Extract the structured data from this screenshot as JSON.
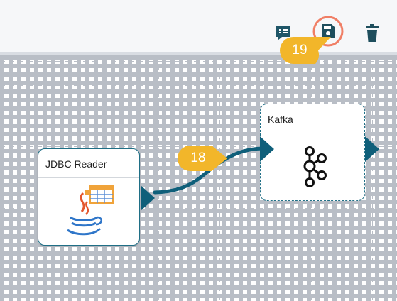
{
  "toolbar": {
    "icons": {
      "list_icon": "list-comment-icon",
      "save_icon": "save-icon",
      "delete_icon": "trash-icon"
    },
    "save_highlight_color": "#f07f66"
  },
  "nodes": {
    "jdbc_reader": {
      "title": "JDBC Reader",
      "icon": "java-table-icon"
    },
    "kafka": {
      "title": "Kafka",
      "icon": "kafka-icon"
    }
  },
  "callouts": {
    "step_18": "18",
    "step_19": "19"
  },
  "colors": {
    "accent": "#0f5f7a",
    "callout": "#f2b62a",
    "node_border": "#1f6f86",
    "icon_dark": "#1e4e5d"
  }
}
